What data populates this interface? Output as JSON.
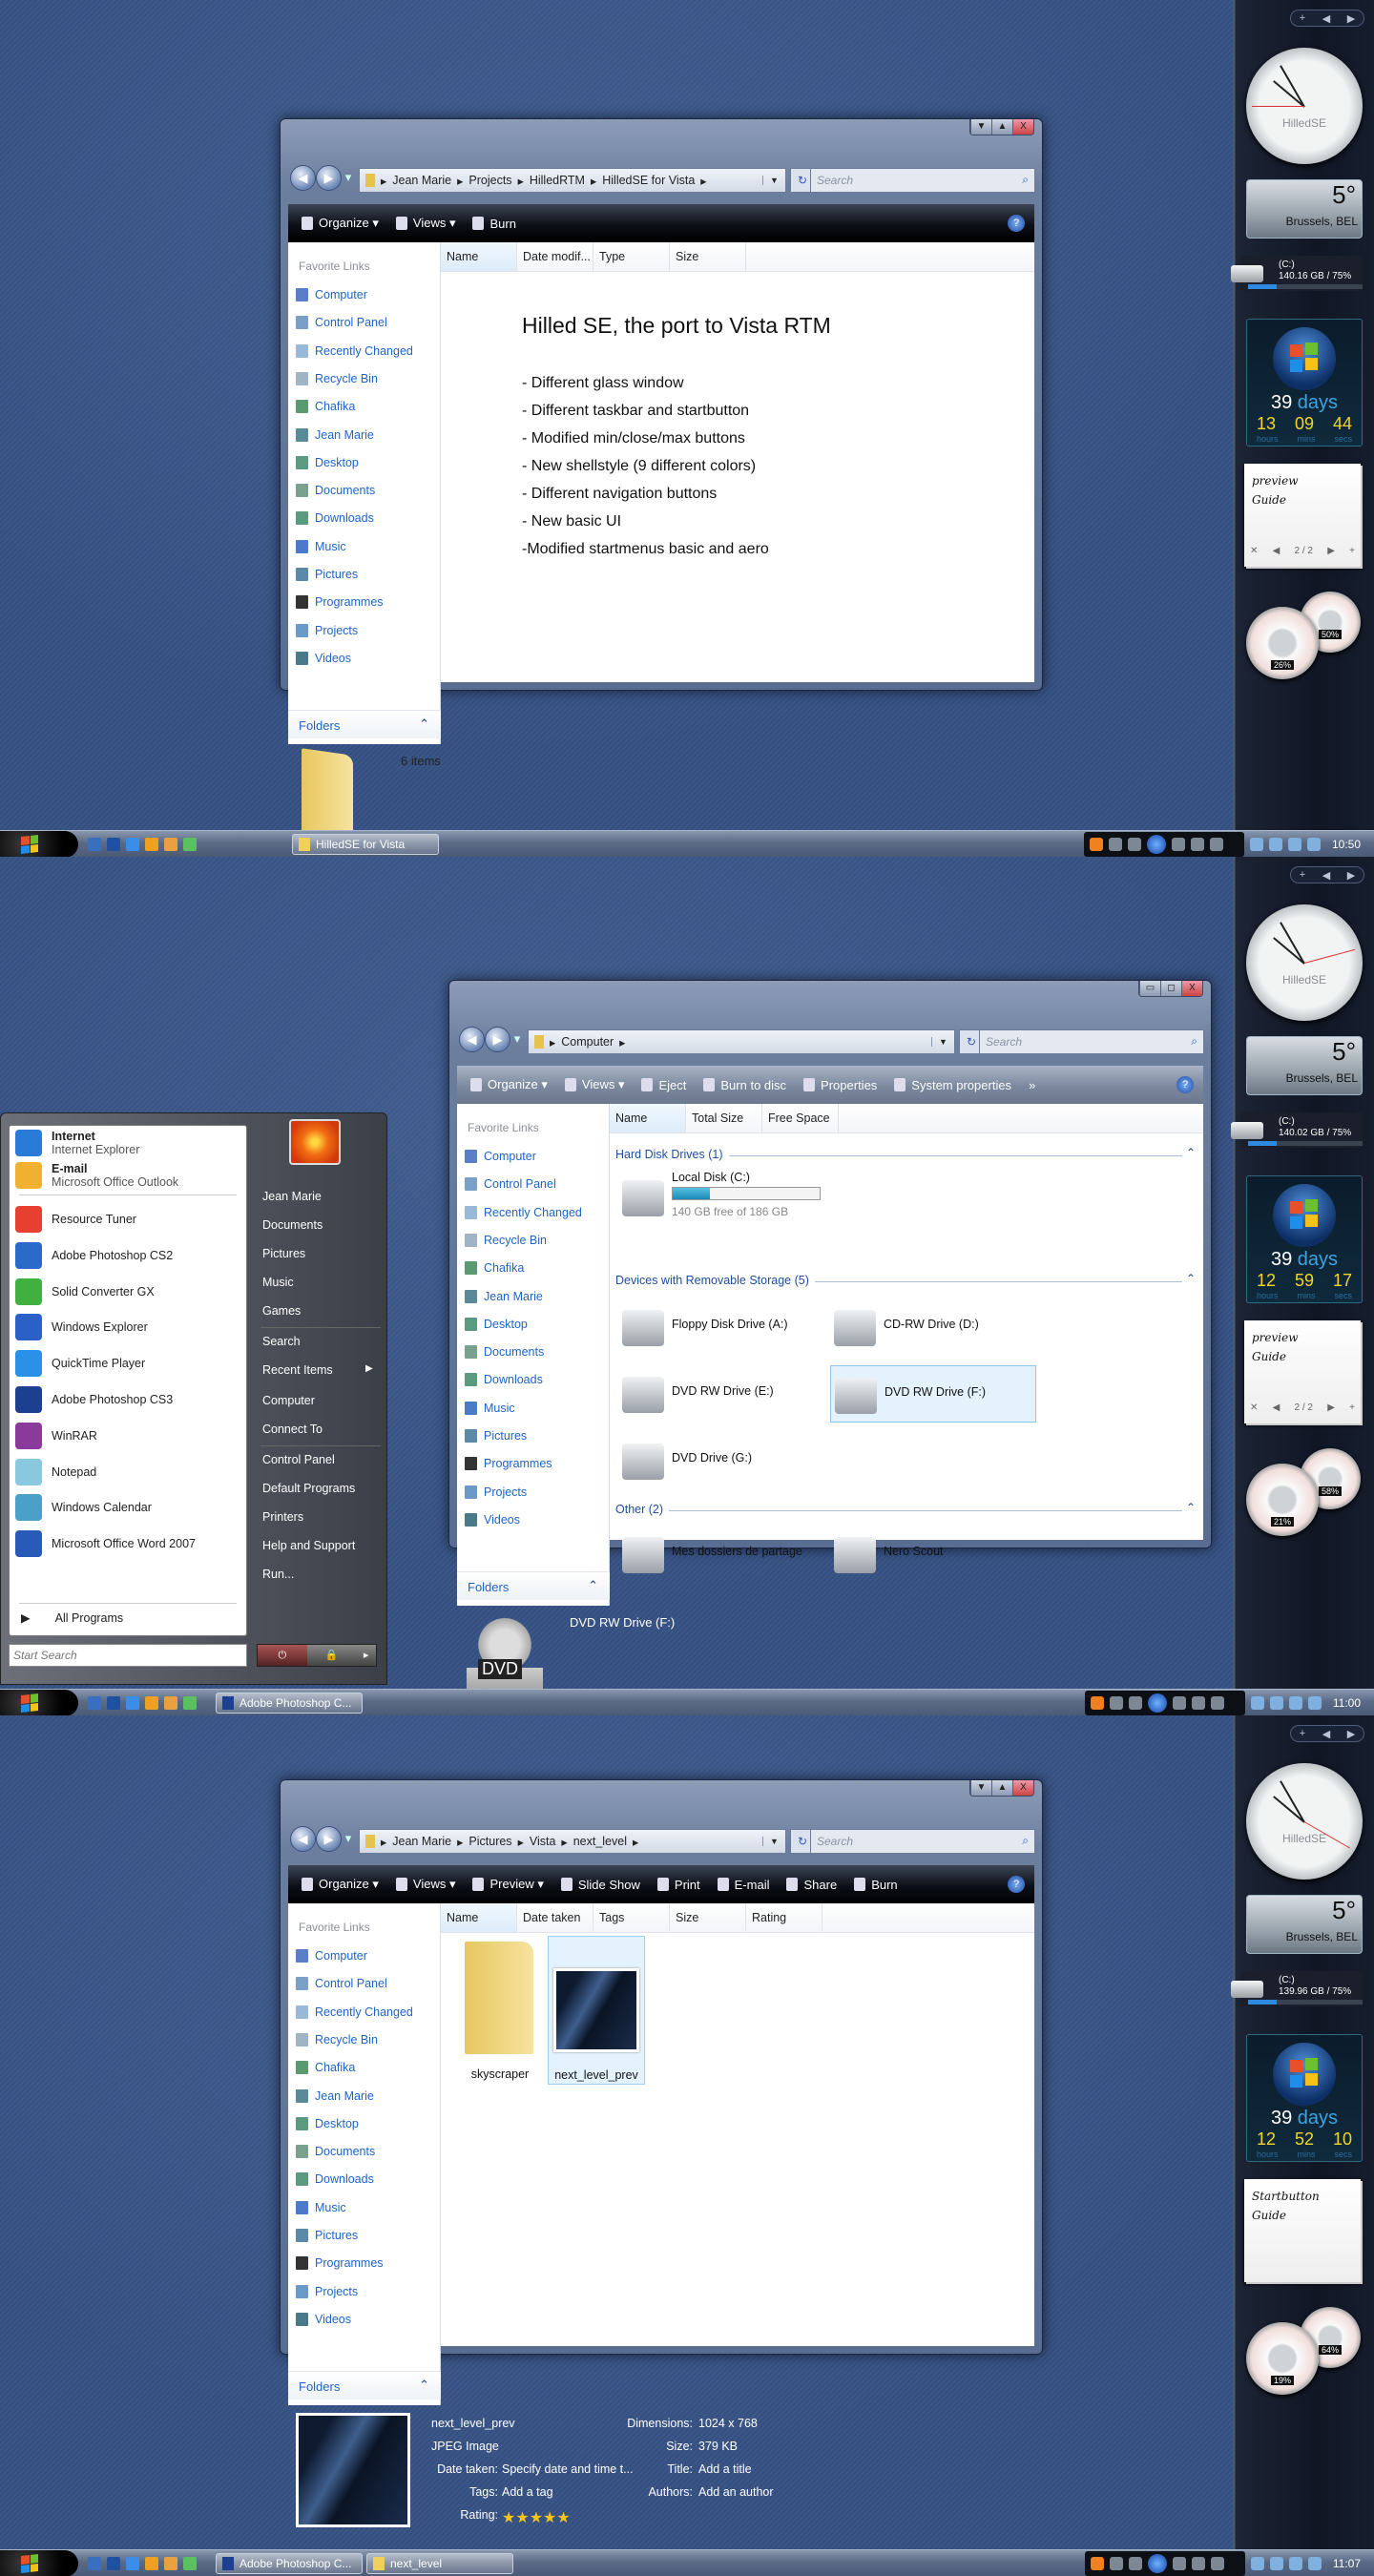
{
  "panels": [
    {
      "window": {
        "kind": "text",
        "title_buttons": [
          "▼",
          "▲",
          "X"
        ],
        "nav": [
          "◀",
          "▶",
          "▾"
        ],
        "breadcrumb": [
          "Jean Marie",
          "Projects",
          "HilledRTM",
          "HilledSE for Vista"
        ],
        "search_placeholder": "Search",
        "toolbar": [
          "Organize ▾",
          "Views ▾",
          "Burn"
        ],
        "toolbar_style": "black",
        "help": "?",
        "columns": [
          "Name",
          "Date modif...",
          "Type",
          "Size"
        ],
        "nav_header": "Favorite Links",
        "nav_items": [
          "Computer",
          "Control Panel",
          "Recently Changed",
          "Recycle Bin",
          "Chafika",
          "Jean Marie",
          "Desktop",
          "Documents",
          "Downloads",
          "Music",
          "Pictures",
          "Programmes",
          "Projects",
          "Videos"
        ],
        "folders_label": "Folders",
        "heading": "Hilled SE, the port to Vista RTM",
        "bullets": [
          "- Different glass window",
          "- Different taskbar and startbutton",
          "- Modified min/close/max buttons",
          "- New shellstyle (9 different colors)",
          "- Different navigation buttons",
          "- New basic UI",
          "-Modified startmenus basic and aero"
        ],
        "status": "6 items"
      },
      "taskbar": {
        "tasks": [
          {
            "label": "HilledSE for Vista",
            "icon": "folder-icon"
          }
        ],
        "clock": "10:50"
      },
      "gadgets": {
        "clock_brand": "HilledSE",
        "temp": "5°",
        "city": "Brussels, BEL",
        "drive_label": "(C:)",
        "drive_info": "140.16 GB / 75%",
        "drive_pct": 75,
        "days": "39",
        "days_label": "days",
        "hours": "13",
        "mins": "09",
        "secs": "44",
        "units": [
          "hours",
          "mins",
          "secs"
        ],
        "note": [
          "preview",
          "Guide"
        ],
        "note_page": "2 / 2",
        "cpu": "26%",
        "mem": "50%",
        "toolbar": [
          "+",
          "◀",
          "▶"
        ]
      }
    },
    {
      "window": {
        "kind": "computer",
        "title_buttons": [
          "▭",
          "◻",
          "X"
        ],
        "nav": [
          "◀",
          "▶",
          "▾"
        ],
        "breadcrumb": [
          "Computer"
        ],
        "search_placeholder": "Search",
        "toolbar": [
          "Organize ▾",
          "Views ▾",
          "Eject",
          "Burn to disc",
          "Properties",
          "System properties",
          "»"
        ],
        "toolbar_style": "gray",
        "help": "?",
        "columns": [
          "Name",
          "Total Size",
          "Free Space"
        ],
        "nav_header": "Favorite Links",
        "nav_items": [
          "Computer",
          "Control Panel",
          "Recently Changed",
          "Recycle Bin",
          "Chafika",
          "Jean Marie",
          "Desktop",
          "Documents",
          "Downloads",
          "Music",
          "Pictures",
          "Programmes",
          "Projects",
          "Videos"
        ],
        "folders_label": "Folders",
        "groups": [
          {
            "title": "Hard Disk Drives (1)",
            "items": [
              {
                "name": "Local Disk (C:)",
                "sub": "140 GB free of 186 GB",
                "used_pct": 25
              }
            ]
          },
          {
            "title": "Devices with Removable Storage (5)",
            "items": [
              {
                "name": "Floppy Disk Drive (A:)"
              },
              {
                "name": "CD-RW Drive (D:)"
              },
              {
                "name": "DVD RW Drive (E:)"
              },
              {
                "name": "DVD RW Drive (F:)",
                "selected": true
              },
              {
                "name": "DVD Drive (G:)"
              }
            ]
          },
          {
            "title": "Other (2)",
            "items": [
              {
                "name": "Mes dossiers de partage"
              },
              {
                "name": "Nero Scout"
              }
            ]
          }
        ],
        "status": "DVD RW Drive (F:)",
        "status_icon_label": "DVD"
      },
      "startmenu": {
        "pinned": [
          {
            "title": "Internet",
            "sub": "Internet Explorer"
          },
          {
            "title": "E-mail",
            "sub": "Microsoft Office Outlook"
          }
        ],
        "recent": [
          "Resource Tuner",
          "Adobe Photoshop CS2",
          "Solid Converter GX",
          "Windows Explorer",
          "QuickTime Player",
          "Adobe Photoshop CS3",
          "WinRAR",
          "Notepad",
          "Windows Calendar",
          "Microsoft Office Word 2007"
        ],
        "all_programs": "All Programs",
        "right": [
          "Jean Marie",
          "Documents",
          "Pictures",
          "Music",
          "Games",
          "Search",
          "Recent Items",
          "Computer",
          "Connect To",
          "Control Panel",
          "Default Programs",
          "Printers",
          "Help and Support",
          "Run..."
        ],
        "search_placeholder": "Start Search"
      },
      "taskbar": {
        "tasks": [
          {
            "label": "Adobe Photoshop C...",
            "icon": "photoshop-icon"
          }
        ],
        "clock": "11:00"
      },
      "gadgets": {
        "clock_brand": "HilledSE",
        "temp": "5°",
        "city": "Brussels, BEL",
        "drive_label": "(C:)",
        "drive_info": "140.02 GB / 75%",
        "drive_pct": 75,
        "days": "39",
        "days_label": "days",
        "hours": "12",
        "mins": "59",
        "secs": "17",
        "units": [
          "hours",
          "mins",
          "secs"
        ],
        "note": [
          "preview",
          "Guide"
        ],
        "note_page": "2 / 2",
        "cpu": "21%",
        "mem": "58%",
        "toolbar": [
          "+",
          "◀",
          "▶"
        ]
      }
    },
    {
      "window": {
        "kind": "pictures",
        "title_buttons": [
          "▼",
          "▲",
          "X"
        ],
        "nav": [
          "◀",
          "▶",
          "▾"
        ],
        "breadcrumb": [
          "Jean Marie",
          "Pictures",
          "Vista",
          "next_level"
        ],
        "search_placeholder": "Search",
        "toolbar": [
          "Organize ▾",
          "Views ▾",
          "Preview ▾",
          "Slide Show",
          "Print",
          "E-mail",
          "Share",
          "Burn"
        ],
        "toolbar_style": "black",
        "help": "?",
        "columns": [
          "Name",
          "Date taken",
          "Tags",
          "Size",
          "Rating"
        ],
        "nav_header": "Favorite Links",
        "nav_items": [
          "Computer",
          "Control Panel",
          "Recently Changed",
          "Recycle Bin",
          "Chafika",
          "Jean Marie",
          "Desktop",
          "Documents",
          "Downloads",
          "Music",
          "Pictures",
          "Programmes",
          "Projects",
          "Videos"
        ],
        "folders_label": "Folders",
        "files": [
          {
            "name": "skyscraper",
            "type": "folder"
          },
          {
            "name": "next_level_prev",
            "type": "image",
            "selected": true
          }
        ],
        "details": {
          "name": "next_level_prev",
          "type": "JPEG Image",
          "fields_left": [
            {
              "k": "Date taken:",
              "v": "Specify date and time t..."
            },
            {
              "k": "Tags:",
              "v": "Add a tag"
            },
            {
              "k": "Rating:",
              "v": "★★★★★"
            }
          ],
          "fields_right": [
            {
              "k": "Dimensions:",
              "v": "1024 x 768"
            },
            {
              "k": "Size:",
              "v": "379 KB"
            },
            {
              "k": "Title:",
              "v": "Add a title"
            },
            {
              "k": "Authors:",
              "v": "Add an author"
            }
          ],
          "rating": 5
        }
      },
      "taskbar": {
        "tasks": [
          {
            "label": "Adobe Photoshop C...",
            "icon": "photoshop-icon"
          },
          {
            "label": "next_level",
            "icon": "folder-icon"
          }
        ],
        "clock": "11:07"
      },
      "gadgets": {
        "clock_brand": "HilledSE",
        "temp": "5°",
        "city": "Brussels, BEL",
        "drive_label": "(C:)",
        "drive_info": "139.96 GB / 75%",
        "drive_pct": 75,
        "days": "39",
        "days_label": "days",
        "hours": "12",
        "mins": "52",
        "secs": "10",
        "units": [
          "hours",
          "mins",
          "secs"
        ],
        "note": [
          "Startbutton",
          "Guide"
        ],
        "cpu": "19%",
        "mem": "64%",
        "toolbar": [
          "+",
          "◀",
          "▶"
        ]
      }
    }
  ],
  "colors": {
    "link": "#1e64c8",
    "desktop": "#3b5688",
    "accent": "#2d8ae0"
  }
}
